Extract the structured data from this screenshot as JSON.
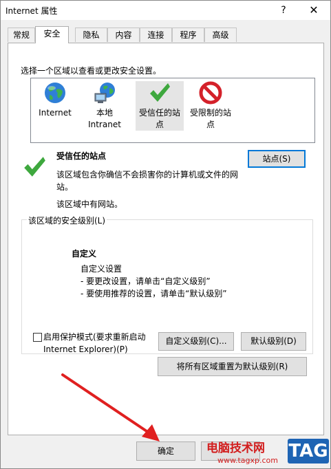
{
  "window": {
    "title": "Internet 属性",
    "help_glyph": "?",
    "close_glyph": "✕"
  },
  "tabs": [
    "常规",
    "安全",
    "隐私",
    "内容",
    "连接",
    "程序",
    "高级"
  ],
  "active_tab": "安全",
  "security": {
    "instruction": "选择一个区域以查看或更改安全设置。",
    "zones": [
      {
        "label_line1": "Internet",
        "label_line2": "",
        "icon": "globe-icon"
      },
      {
        "label_line1": "本地",
        "label_line2": "Intranet",
        "icon": "intranet-icon"
      },
      {
        "label_line1": "受信任的站",
        "label_line2": "点",
        "icon": "checkmark-icon",
        "selected": true
      },
      {
        "label_line1": "受限制的站",
        "label_line2": "点",
        "icon": "restricted-icon"
      }
    ],
    "selected_zone": {
      "title": "受信任的站点",
      "description": "该区域包含你确信不会损害你的计算机或文件的网站。",
      "status": "该区域中有网站。",
      "sites_button": "站点(S)"
    },
    "level_group": {
      "label": "该区域的安全级别(L)",
      "level_name": "自定义",
      "level_lines": [
        "自定义设置",
        "- 要更改设置，请单击“自定义级别”",
        "- 要使用推荐的设置，请单击“默认级别”"
      ],
      "protected_mode_label_line1": "启用保护模式(要求重新启动",
      "protected_mode_label_line2": "Internet Explorer)(P)",
      "protected_mode_checked": false,
      "custom_level_button": "自定义级别(C)...",
      "default_level_button": "默认级别(D)"
    },
    "reset_all_button": "将所有区域重置为默认级别(R)"
  },
  "footer": {
    "ok_button": "确定"
  },
  "watermark": {
    "name": "电脑技术网",
    "url": "www.tagxp.com",
    "tag": "TAG"
  },
  "colors": {
    "accent": "#0078d7",
    "check_green": "#3ea83e",
    "restricted_red": "#d4212a",
    "arrow_red": "#e02020"
  }
}
